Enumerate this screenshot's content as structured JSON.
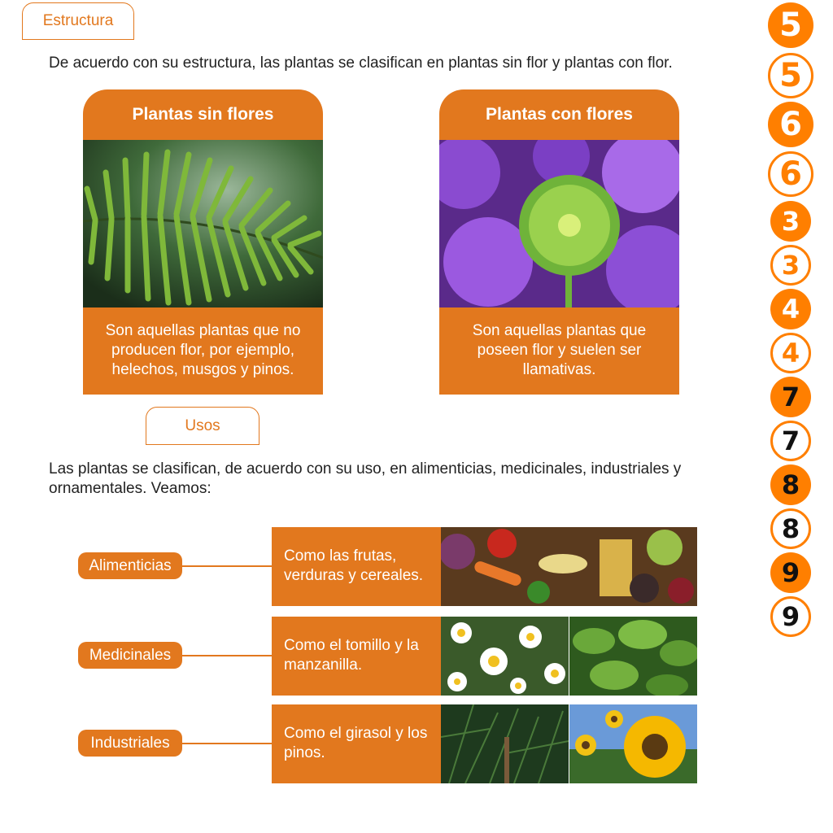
{
  "tabs": {
    "estructura": "Estructura",
    "usos": "Usos"
  },
  "intro": "De acuerdo con su estructura, las plantas se clasifican en plantas sin flor y plantas con flor.",
  "cards": [
    {
      "title": "Plantas sin flores",
      "text": "Son aquellas plantas que no producen flor, por ejemplo, helechos, musgos y pinos."
    },
    {
      "title": "Plantas con flores",
      "text": "Son aquellas plantas que poseen flor y suelen ser llamativas."
    }
  ],
  "usos_intro": "Las plantas se clasifican, de acuerdo con su uso, en alimenticias, medicinales, industriales y ornamentales. Veamos:",
  "uses": [
    {
      "label": "Alimenticias",
      "text": "Como las frutas, verduras y cereales."
    },
    {
      "label": "Medicinales",
      "text": "Como el tomillo y la manzanilla."
    },
    {
      "label": "Industriales",
      "text": "Como el girasol y los pinos."
    }
  ],
  "numbers": [
    "5",
    "5",
    "6",
    "6",
    "3",
    "3",
    "4",
    "4",
    "7",
    "7",
    "8",
    "8",
    "9",
    "9"
  ],
  "colors": {
    "accent": "#e2781e",
    "badge": "#ff7f00"
  }
}
